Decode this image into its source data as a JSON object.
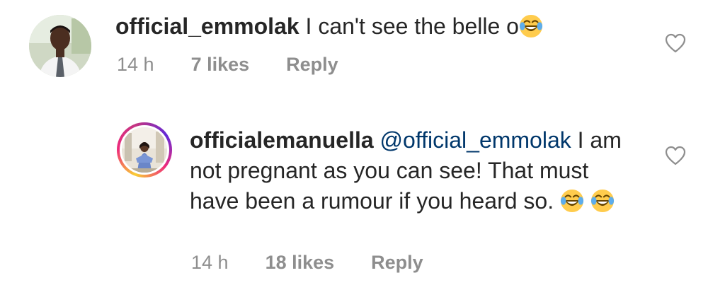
{
  "comments": [
    {
      "username": "official_emmolak",
      "text": " I can't see the belle o",
      "emoji": "joy-emoji",
      "time": "14 h",
      "likes": "7 likes",
      "reply": "Reply"
    },
    {
      "username": "officialemanuella",
      "mention": "@official_emmolak",
      "text": " I am not pregnant as you can see! That must have been a rumour if you heard so. ",
      "emoji": "joy-emoji",
      "time": "14 h",
      "likes": "18 likes",
      "reply": "Reply"
    }
  ],
  "colors": {
    "text": "#262626",
    "meta": "#8e8e8e",
    "mention": "#00376b"
  }
}
